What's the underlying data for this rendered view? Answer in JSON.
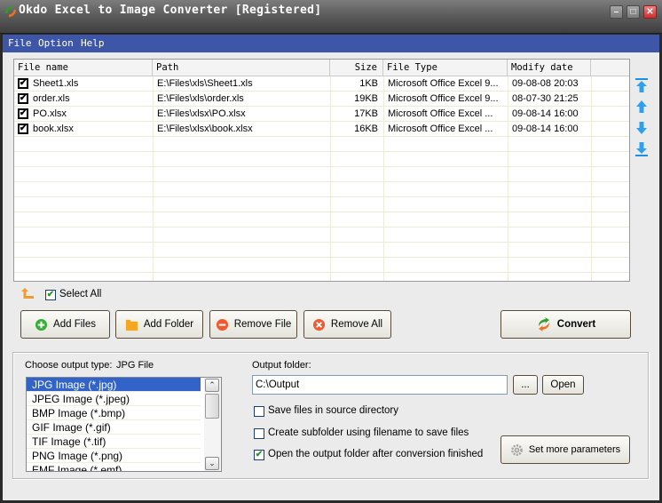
{
  "window": {
    "title": "Okdo Excel to Image Converter [Registered]",
    "controls": [
      "minimize",
      "maximize",
      "close"
    ]
  },
  "menu": {
    "items": [
      "File",
      "Option",
      "Help"
    ]
  },
  "table": {
    "columns": [
      "File name",
      "Path",
      "Size",
      "File Type",
      "Modify date"
    ],
    "rows": [
      {
        "checked": true,
        "name": "Sheet1.xls",
        "path": "E:\\Files\\xls\\Sheet1.xls",
        "size": "1KB",
        "type": "Microsoft Office Excel 9...",
        "date": "09-08-08 20:03"
      },
      {
        "checked": true,
        "name": "order.xls",
        "path": "E:\\Files\\xls\\order.xls",
        "size": "19KB",
        "type": "Microsoft Office Excel 9...",
        "date": "08-07-30 21:25"
      },
      {
        "checked": true,
        "name": "PO.xlsx",
        "path": "E:\\Files\\xlsx\\PO.xlsx",
        "size": "17KB",
        "type": "Microsoft Office Excel ...",
        "date": "09-08-14 16:00"
      },
      {
        "checked": true,
        "name": "book.xlsx",
        "path": "E:\\Files\\xlsx\\book.xlsx",
        "size": "16KB",
        "type": "Microsoft Office Excel ...",
        "date": "09-08-14 16:00"
      }
    ],
    "side_buttons": [
      "move-top",
      "move-up",
      "move-down",
      "move-bottom"
    ]
  },
  "select_all": {
    "label": "Select All",
    "checked": true
  },
  "actions": {
    "add_files": "Add Files",
    "add_folder": "Add Folder",
    "remove_file": "Remove File",
    "remove_all": "Remove All",
    "convert": "Convert"
  },
  "output": {
    "type_label": "Choose output type:",
    "type_value": "JPG File",
    "types": [
      "JPG Image (*.jpg)",
      "JPEG Image (*.jpeg)",
      "BMP Image (*.bmp)",
      "GIF Image (*.gif)",
      "TIF Image (*.tif)",
      "PNG Image (*.png)",
      "EMF Image (*.emf)"
    ],
    "selected_index": 0,
    "folder_label": "Output folder:",
    "folder_value": "C:\\Output",
    "browse_label": "...",
    "open_label": "Open",
    "options": [
      {
        "label": "Save files in source directory",
        "checked": false
      },
      {
        "label": "Create subfolder using filename to save files",
        "checked": false
      },
      {
        "label": "Open the output folder after conversion finished",
        "checked": true
      }
    ],
    "more_params": "Set more parameters"
  },
  "colors": {
    "menubar": "#3d56a8",
    "selection": "#3163c8",
    "arrow_blue": "#1e90e0",
    "up_orange": "#f39a2c"
  }
}
